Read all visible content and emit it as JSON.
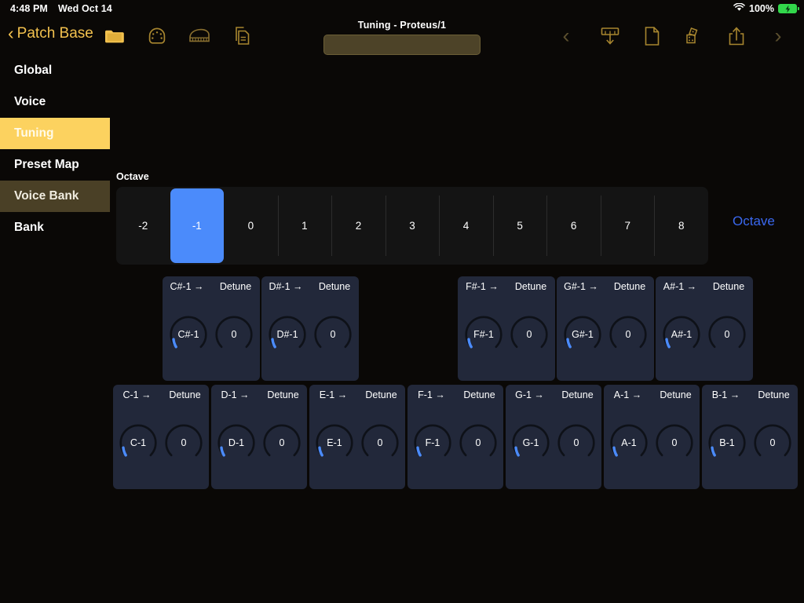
{
  "statusbar": {
    "time": "4:48 PM",
    "date": "Wed Oct 14",
    "battery_percent": "100%",
    "wifi_icon": "wifi-icon",
    "battery_icon": "battery-charging-icon"
  },
  "toolbar": {
    "back_label": "Patch Base",
    "back_chevron": "‹",
    "left_icons": [
      {
        "name": "folder-icon",
        "color": "#f2c14e"
      },
      {
        "name": "midi-din-icon",
        "color": "#a8862f"
      },
      {
        "name": "piano-icon",
        "color": "#8a7030"
      },
      {
        "name": "copy-document-icon",
        "color": "#a8862f"
      }
    ],
    "title": "Tuning - Proteus/1",
    "patch_name_value": "",
    "patch_name_placeholder": "",
    "right_icons": [
      {
        "name": "prev-patch-arrow-icon",
        "glyph": "‹"
      },
      {
        "name": "download-to-synth-icon",
        "color": "#a8862f"
      },
      {
        "name": "new-document-icon",
        "color": "#a8862f"
      },
      {
        "name": "randomize-dice-icon",
        "color": "#a8862f"
      },
      {
        "name": "share-export-icon",
        "color": "#a8862f"
      },
      {
        "name": "next-patch-arrow-icon",
        "glyph": "›"
      }
    ]
  },
  "sidebar": {
    "items": [
      {
        "label": "Global",
        "state": "normal"
      },
      {
        "label": "Voice",
        "state": "normal"
      },
      {
        "label": "Tuning",
        "state": "active"
      },
      {
        "label": "Preset Map",
        "state": "normal"
      },
      {
        "label": "Voice Bank",
        "state": "sub"
      },
      {
        "label": "Bank",
        "state": "normal"
      }
    ],
    "active_color": "#fcd25f",
    "sub_color": "#4a4026"
  },
  "main": {
    "octave": {
      "label": "Octave",
      "right_label": "Octave",
      "right_label_color": "#3a68ef",
      "selected": "-1",
      "selected_color": "#4b8bfb",
      "options": [
        "-2",
        "-1",
        "0",
        "1",
        "2",
        "3",
        "4",
        "5",
        "6",
        "7",
        "8"
      ]
    },
    "note_panels": {
      "arrow_glyph": "→",
      "detune_label": "Detune",
      "black_keys": [
        {
          "note": "C#-1",
          "note_knob": "C#-1",
          "detune": "0"
        },
        {
          "note": "D#-1",
          "note_knob": "D#-1",
          "detune": "0"
        },
        {
          "note": "F#-1",
          "note_knob": "F#-1",
          "detune": "0"
        },
        {
          "note": "G#-1",
          "note_knob": "G#-1",
          "detune": "0"
        },
        {
          "note": "A#-1",
          "note_knob": "A#-1",
          "detune": "0"
        }
      ],
      "white_keys": [
        {
          "note": "C-1",
          "note_knob": "C-1",
          "detune": "0"
        },
        {
          "note": "D-1",
          "note_knob": "D-1",
          "detune": "0"
        },
        {
          "note": "E-1",
          "note_knob": "E-1",
          "detune": "0"
        },
        {
          "note": "F-1",
          "note_knob": "F-1",
          "detune": "0"
        },
        {
          "note": "G-1",
          "note_knob": "G-1",
          "detune": "0"
        },
        {
          "note": "A-1",
          "note_knob": "A-1",
          "detune": "0"
        },
        {
          "note": "B-1",
          "note_knob": "B-1",
          "detune": "0"
        }
      ]
    }
  }
}
